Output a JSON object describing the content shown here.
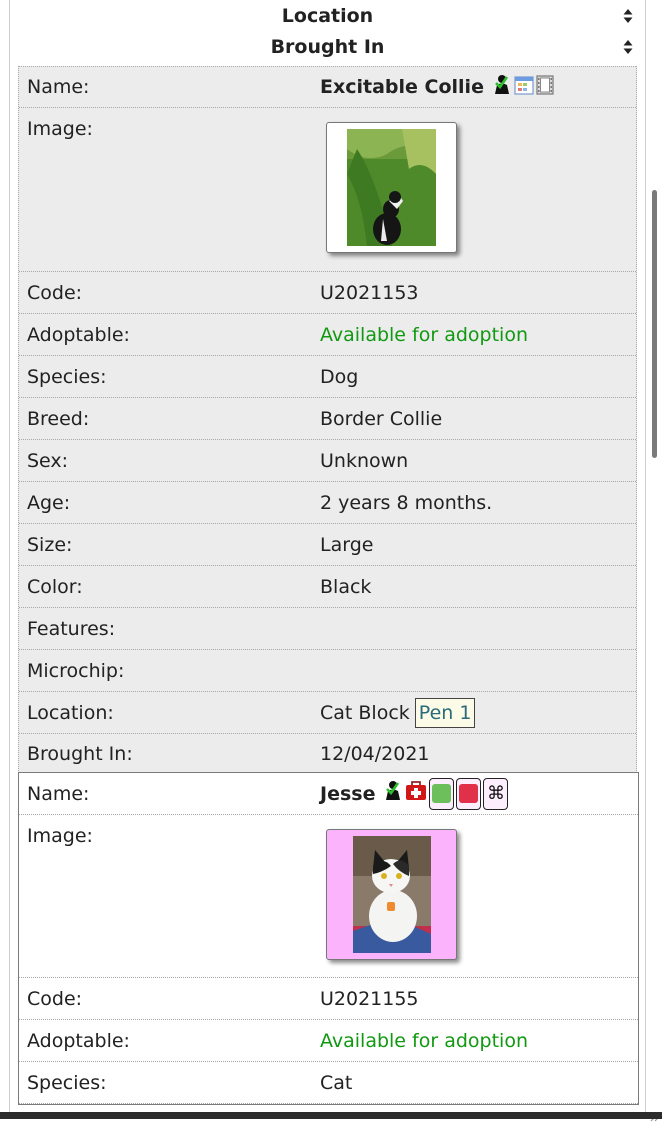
{
  "sort_headers": [
    {
      "label": "Location"
    },
    {
      "label": "Brought In"
    }
  ],
  "colors": {
    "adoptable_green": "#119911",
    "pen_link": "#2a6a7a",
    "flag_green": "#6cbf5a",
    "flag_red": "#e0304a",
    "thumb_pink": "#fbb4fb"
  },
  "animals": [
    {
      "rows": {
        "name": {
          "label": "Name:",
          "value": "Excitable Collie"
        },
        "image": {
          "label": "Image:"
        },
        "code": {
          "label": "Code:",
          "value": "U2021153"
        },
        "adoptable": {
          "label": "Adoptable:",
          "value": "Available for adoption"
        },
        "species": {
          "label": "Species:",
          "value": "Dog"
        },
        "breed": {
          "label": "Breed:",
          "value": "Border Collie"
        },
        "sex": {
          "label": "Sex:",
          "value": "Unknown"
        },
        "age": {
          "label": "Age:",
          "value": "2 years 8 months."
        },
        "size": {
          "label": "Size:",
          "value": "Large"
        },
        "color": {
          "label": "Color:",
          "value": "Black"
        },
        "features": {
          "label": "Features:",
          "value": ""
        },
        "microchip": {
          "label": "Microchip:",
          "value": ""
        },
        "location": {
          "label": "Location:",
          "value": "Cat Block",
          "pen": "Pen 1"
        },
        "brought_in": {
          "label": "Brought In:",
          "value": "12/04/2021"
        }
      },
      "icons": [
        "adoptable-person-icon",
        "calendar-icon",
        "film-strip-icon"
      ]
    },
    {
      "rows": {
        "name": {
          "label": "Name:",
          "value": "Jesse"
        },
        "image": {
          "label": "Image:"
        },
        "code": {
          "label": "Code:",
          "value": "U2021155"
        },
        "adoptable": {
          "label": "Adoptable:",
          "value": "Available for adoption"
        },
        "species": {
          "label": "Species:",
          "value": "Cat"
        }
      },
      "icons": [
        "adoptable-person-icon",
        "medical-kit-icon",
        "green-flag-icon",
        "red-flag-icon",
        "command-key-icon"
      ],
      "flag_symbol": "⌘"
    }
  ]
}
